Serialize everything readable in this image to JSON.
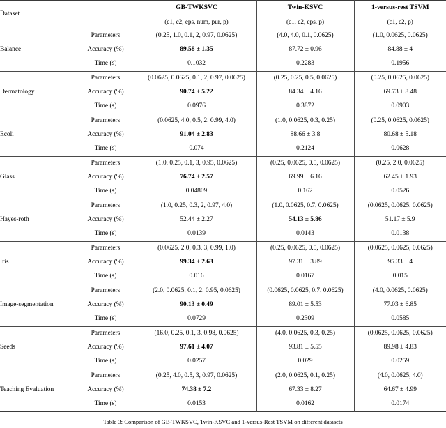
{
  "table": {
    "columns": {
      "dataset_header": "Dataset",
      "metric_header": "",
      "algorithms": [
        {
          "name": "GB-TWKSVC",
          "params_legend": "(c1, c2, eps, num, pur, p)"
        },
        {
          "name": "Twin-KSVC",
          "params_legend": "(c1, c2, eps, p)"
        },
        {
          "name": "1-versus-rest TSVM",
          "params_legend": "(c1, c2, p)"
        }
      ]
    },
    "metric_labels": [
      "Parameters",
      "Accuracy (%)",
      "Time (s)"
    ],
    "rows": [
      {
        "dataset": "Balance",
        "gb": {
          "parameters": "(0.25, 1.0, 0.1, 2, 0.97, 0.0625)",
          "accuracy": "89.58 ± 1.35",
          "accuracy_bold": true,
          "time": "0.1032"
        },
        "twin": {
          "parameters": "(4.0, 4.0, 0.1, 0.0625)",
          "accuracy": "87.72 ± 0.96",
          "accuracy_bold": false,
          "time": "0.2283"
        },
        "tsvm": {
          "parameters": "(1.0, 0.0625, 0.0625)",
          "accuracy": "84.88 ± 4",
          "accuracy_bold": false,
          "time": "0.1956"
        }
      },
      {
        "dataset": "Dermatology",
        "gb": {
          "parameters": "(0.0625, 0.0625, 0.1, 2, 0.97, 0.0625)",
          "accuracy": "90.74 ± 5.22",
          "accuracy_bold": true,
          "time": "0.0976"
        },
        "twin": {
          "parameters": "(0.25, 0.25, 0.5, 0.0625)",
          "accuracy": "84.34 ± 4.16",
          "accuracy_bold": false,
          "time": "0.3872"
        },
        "tsvm": {
          "parameters": "(0.25, 0.0625, 0.0625)",
          "accuracy": "69.73 ± 8.48",
          "accuracy_bold": false,
          "time": "0.0903"
        }
      },
      {
        "dataset": "Ecoli",
        "gb": {
          "parameters": "(0.0625, 4.0, 0.5, 2, 0.99, 4.0)",
          "accuracy": "91.04 ± 2.83",
          "accuracy_bold": true,
          "time": "0.074"
        },
        "twin": {
          "parameters": "(1.0, 0.0625, 0.3, 0.25)",
          "accuracy": "88.66 ± 3.8",
          "accuracy_bold": false,
          "time": "0.2124"
        },
        "tsvm": {
          "parameters": "(0.25, 0.0625, 0.0625)",
          "accuracy": "80.68 ± 5.18",
          "accuracy_bold": false,
          "time": "0.0628"
        }
      },
      {
        "dataset": "Glass",
        "gb": {
          "parameters": "(1.0, 0.25, 0.1, 3, 0.95, 0.0625)",
          "accuracy": "76.74 ± 2.57",
          "accuracy_bold": true,
          "time": "0.04809"
        },
        "twin": {
          "parameters": "(0.25, 0.0625, 0.5, 0.0625)",
          "accuracy": "69.99 ± 6.16",
          "accuracy_bold": false,
          "time": "0.162"
        },
        "tsvm": {
          "parameters": "(0.25, 2.0, 0.0625)",
          "accuracy": "62.45 ± 1.93",
          "accuracy_bold": false,
          "time": "0.0526"
        }
      },
      {
        "dataset": "Hayes-roth",
        "gb": {
          "parameters": "(1.0, 0.25, 0.3, 2, 0.97, 4.0)",
          "accuracy": "52.44 ± 2.27",
          "accuracy_bold": false,
          "time": "0.0139"
        },
        "twin": {
          "parameters": "(1.0, 0.0625, 0.7, 0.0625)",
          "accuracy": "54.13 ± 5.86",
          "accuracy_bold": true,
          "time": "0.0143"
        },
        "tsvm": {
          "parameters": "(0.0625, 0.0625, 0.0625)",
          "accuracy": "51.17 ± 5.9",
          "accuracy_bold": false,
          "time": "0.0138"
        }
      },
      {
        "dataset": "Iris",
        "gb": {
          "parameters": "(0.0625, 2.0, 0.3, 3, 0.99, 1.0)",
          "accuracy": "99.34 ± 2.63",
          "accuracy_bold": true,
          "time": "0.016"
        },
        "twin": {
          "parameters": "(0.25, 0.0625, 0.5, 0.0625)",
          "accuracy": "97.31 ± 3.89",
          "accuracy_bold": false,
          "time": "0.0167"
        },
        "tsvm": {
          "parameters": "(0.0625, 0.0625, 0.0625)",
          "accuracy": "95.33 ± 4",
          "accuracy_bold": false,
          "time": "0.015"
        }
      },
      {
        "dataset": "Image-segmentation",
        "gb": {
          "parameters": "(2.0, 0.0625, 0.1, 2, 0.95, 0.0625)",
          "accuracy": "90.13 ± 0.49",
          "accuracy_bold": true,
          "time": "0.0729"
        },
        "twin": {
          "parameters": "(0.0625, 0.0625, 0.7, 0.0625)",
          "accuracy": "89.01 ± 5.53",
          "accuracy_bold": false,
          "time": "0.2309"
        },
        "tsvm": {
          "parameters": "(4.0, 0.0625, 0.0625)",
          "accuracy": "77.03 ± 6.85",
          "accuracy_bold": false,
          "time": "0.0585"
        }
      },
      {
        "dataset": "Seeds",
        "gb": {
          "parameters": "(16.0, 0.25, 0.1, 3, 0.98, 0.0625)",
          "accuracy": "97.61 ± 4.07",
          "accuracy_bold": true,
          "time": "0.0257"
        },
        "twin": {
          "parameters": "(4.0, 0.0625, 0.3, 0.25)",
          "accuracy": "93.81 ± 5.55",
          "accuracy_bold": false,
          "time": "0.029"
        },
        "tsvm": {
          "parameters": "(0.0625, 0.0625, 0.0625)",
          "accuracy": "89.98 ± 4.83",
          "accuracy_bold": false,
          "time": "0.0259"
        }
      },
      {
        "dataset": "Teaching Evaluation",
        "gb": {
          "parameters": "(0.25, 4.0, 0.5, 3, 0.97, 0.0625)",
          "accuracy": "74.38 ± 7.2",
          "accuracy_bold": true,
          "time": "0.0153"
        },
        "twin": {
          "parameters": "(2.0, 0.0625, 0.1, 0.25)",
          "accuracy": "67.33 ± 8.27",
          "accuracy_bold": false,
          "time": "0.0162"
        },
        "tsvm": {
          "parameters": "(4.0, 0.0625, 4.0)",
          "accuracy": "64.67 ± 4.99",
          "accuracy_bold": false,
          "time": "0.0174"
        }
      }
    ]
  },
  "caption": "Table 3: Comparison of GB-TWKSVC, Twin-KSVC and 1-versus-Rest TSVM on different datasets"
}
